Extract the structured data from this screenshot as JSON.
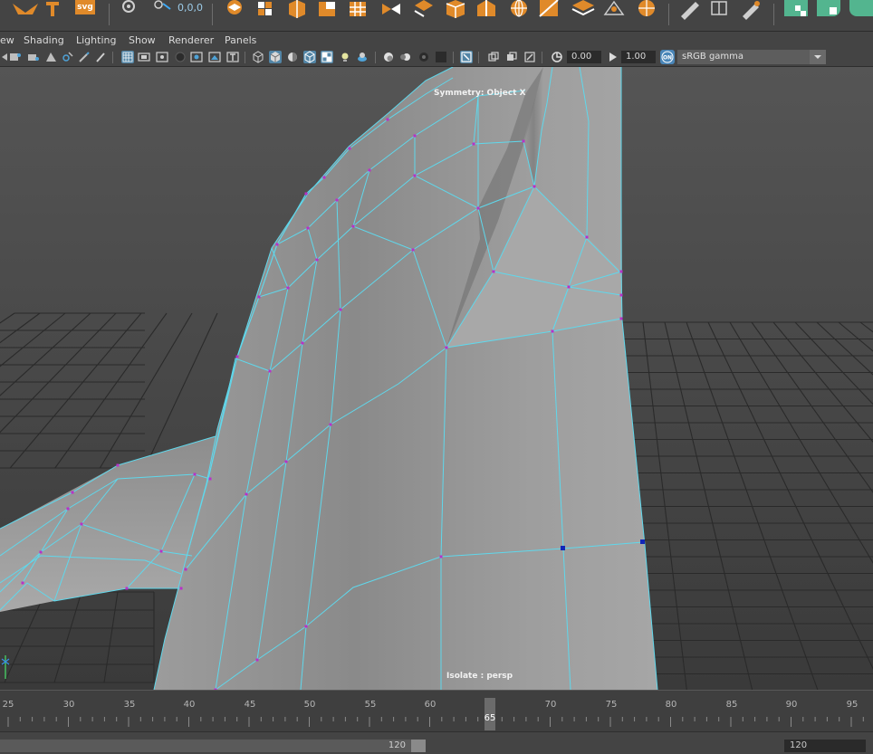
{
  "shelf": {
    "status_text": "0,0,0",
    "svg_label": "svg"
  },
  "menus": [
    "ew",
    "Shading",
    "Lighting",
    "Show",
    "Renderer",
    "Panels"
  ],
  "toolbar": {
    "exposure_value": "0.00",
    "gamma_value": "1.00",
    "color_mgmt_label": "ON",
    "color_space": "sRGB gamma"
  },
  "viewport": {
    "hud_symmetry": "Symmetry: Object X",
    "hud_isolate": "Isolate : persp",
    "wire_color": "#5fd8ec",
    "vertex_color": "#b830c8"
  },
  "timeline": {
    "ticks": [
      "25",
      "30",
      "35",
      "40",
      "45",
      "50",
      "55",
      "60",
      "65",
      "70",
      "75",
      "80",
      "85",
      "90",
      "95"
    ],
    "current_top": "65",
    "current_frame": "65"
  },
  "range": {
    "end_value": "120",
    "playback_end": "120"
  }
}
